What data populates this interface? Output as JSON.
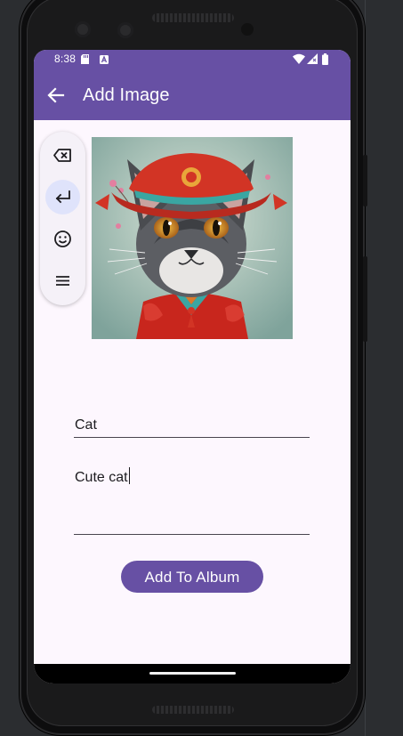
{
  "status_bar": {
    "time": "8:38",
    "icons": [
      "sd-card-icon",
      "notification-a-icon",
      "wifi-icon",
      "signal-icon",
      "battery-icon"
    ]
  },
  "app_bar": {
    "title": "Add Image",
    "back_icon": "arrow-back-icon"
  },
  "image": {
    "subject": "cat-wearing-red-hat-and-robe",
    "colors": {
      "background": "#a9c3bb",
      "robe": "#c8261d",
      "hat": "#d23425",
      "fur": "#5c5e63"
    }
  },
  "form": {
    "name_value": "Cat",
    "description_value": "Cute cat"
  },
  "actions": {
    "add_label": "Add To Album"
  },
  "keyboard_toolbar": {
    "tools": [
      "backspace-icon",
      "enter-icon",
      "emoji-icon",
      "menu-icon"
    ],
    "active": "enter-icon"
  },
  "colors": {
    "primary": "#6750a4",
    "surface": "#fdf7fe",
    "on_surface": "#1c1b1f",
    "toolbar_bg": "#f5f1f8",
    "active_tool": "#dfe3fb"
  }
}
